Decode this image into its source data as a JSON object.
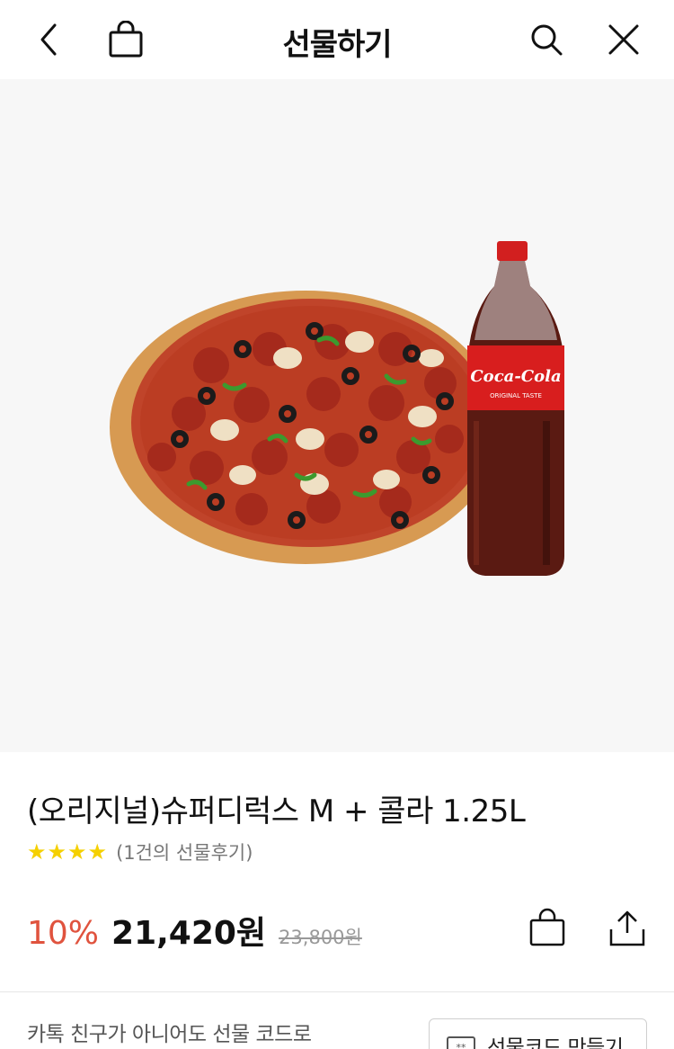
{
  "header": {
    "title": "선물하기",
    "icons": [
      "chevron-left-icon",
      "shopping-bag-icon",
      "search-icon",
      "close-icon"
    ]
  },
  "product": {
    "name": "(오리지널)슈퍼디럭스 M + 콜라 1.25L",
    "rating_stars": 4,
    "review_count_text": "(1건의 선물후기)",
    "discount": "10%",
    "price": "21,420원",
    "original_price": "23,800원",
    "image_label": "Coca-Cola",
    "image_sublabel": "ORIGINAL TASTE"
  },
  "actions": {
    "icons": [
      "shopping-bag-icon",
      "share-icon"
    ]
  },
  "bottom": {
    "text": "카톡 친구가 아니어도 선물 코드로",
    "code_button_label": "선물코드 만들기"
  },
  "colors": {
    "accent_discount": "#e0533e",
    "star": "#f5d000",
    "hero_bg": "#f7f7f7"
  }
}
